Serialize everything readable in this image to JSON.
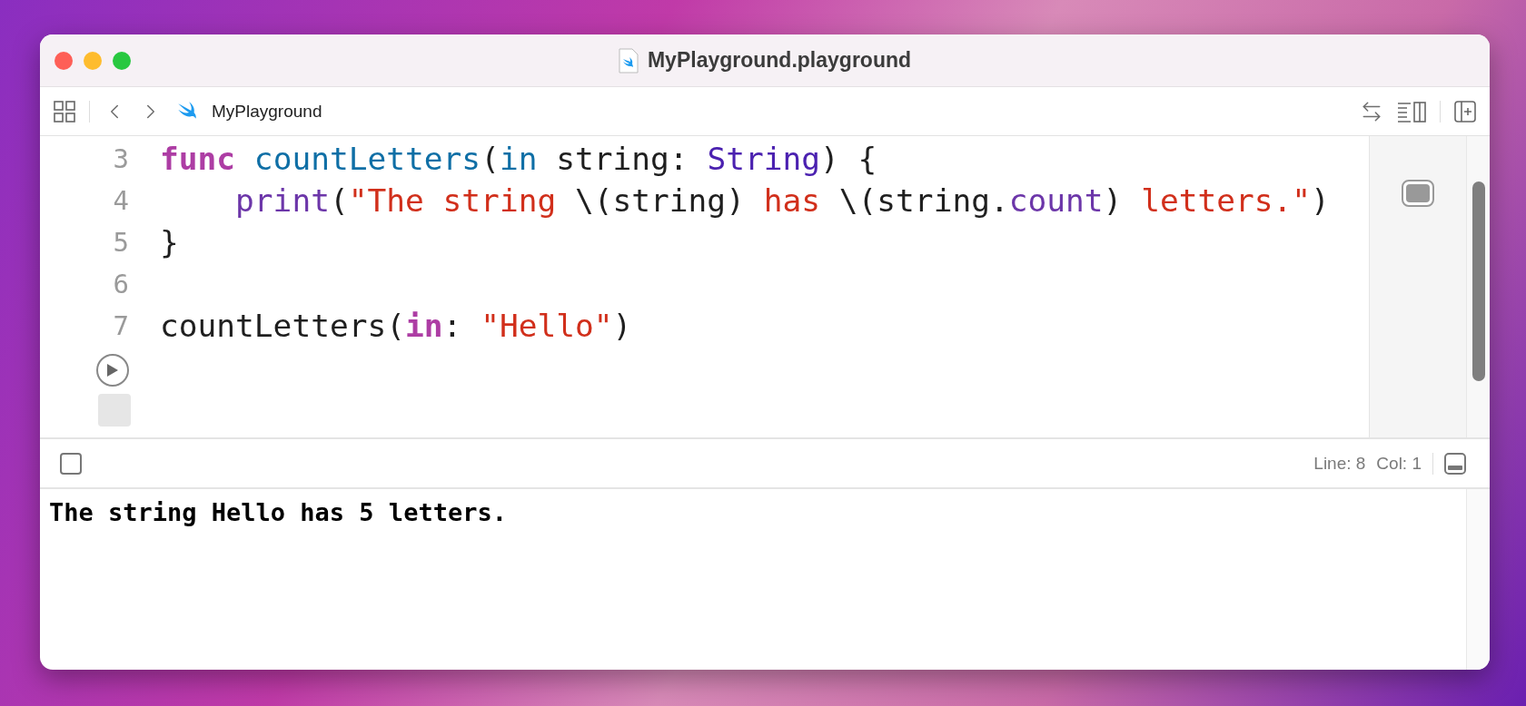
{
  "window": {
    "title": "MyPlayground.playground"
  },
  "toolbar": {
    "breadcrumb": "MyPlayground"
  },
  "editor": {
    "lines": [
      {
        "number": "3",
        "tokens": [
          {
            "text": "func",
            "kind": "keyword"
          },
          {
            "text": " countLetters",
            "kind": "declaration"
          },
          {
            "text": "(",
            "kind": "plain"
          },
          {
            "text": "in",
            "kind": "declaration"
          },
          {
            "text": " string: ",
            "kind": "plain"
          },
          {
            "text": "String",
            "kind": "type"
          },
          {
            "text": ") {",
            "kind": "plain"
          }
        ]
      },
      {
        "number": "4",
        "tokens": [
          {
            "text": "    print",
            "kind": "call"
          },
          {
            "text": "(",
            "kind": "plain"
          },
          {
            "text": "\"The string ",
            "kind": "string"
          },
          {
            "text": "\\(string) ",
            "kind": "plain"
          },
          {
            "text": "has ",
            "kind": "string"
          },
          {
            "text": "\\(string.",
            "kind": "plain"
          },
          {
            "text": "count",
            "kind": "call"
          },
          {
            "text": ") ",
            "kind": "plain"
          },
          {
            "text": "letters.\"",
            "kind": "string"
          },
          {
            "text": ")",
            "kind": "plain"
          }
        ]
      },
      {
        "number": "5",
        "tokens": [
          {
            "text": "}",
            "kind": "plain"
          }
        ]
      },
      {
        "number": "6"
      },
      {
        "number": "7",
        "tokens": [
          {
            "text": "countLetters(",
            "kind": "plain"
          },
          {
            "text": "in",
            "kind": "keyword"
          },
          {
            "text": ": ",
            "kind": "plain"
          },
          {
            "text": "\"Hello\"",
            "kind": "string"
          },
          {
            "text": ")",
            "kind": "plain"
          }
        ]
      }
    ]
  },
  "status_bar": {
    "line": "Line: 8",
    "col": "Col: 1"
  },
  "console": {
    "output": "The string Hello has 5 letters."
  }
}
